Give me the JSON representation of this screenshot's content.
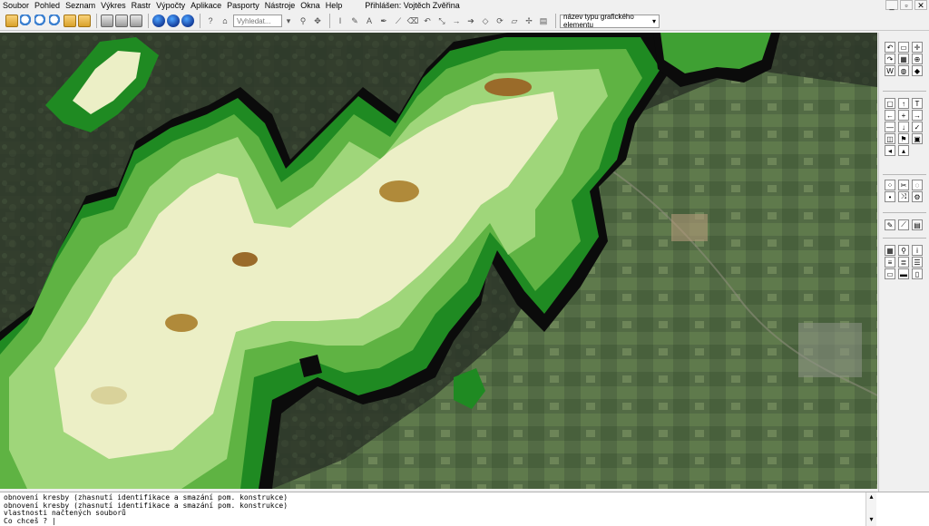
{
  "menu": {
    "items": [
      "Soubor",
      "Pohled",
      "Seznam",
      "Výkres",
      "Rastr",
      "Výpočty",
      "Aplikace",
      "Pasporty",
      "Nástroje",
      "Okna",
      "Help"
    ],
    "login": "Přihlášen: Vojtěch Zvěřina"
  },
  "toolbar": {
    "search_placeholder": "Vyhledat...",
    "element_type": "název typu grafického elementu"
  },
  "console": {
    "lines": [
      "obnovení kresby (zhasnutí identifikace a smazání pom. konstrukce)",
      "obnovení kresby (zhasnutí identifikace a smazání pom. konstrukce)",
      "vlastnosti načtených souborů",
      "Co chceš ? |"
    ]
  },
  "colors": {
    "elev_low": "#1f8a22",
    "elev_mid": "#79c24a",
    "elev_high": "#f4f2c9",
    "elev_peak": "#9a6b2a"
  },
  "icons": [
    "folder-icon",
    "zoom-in-icon",
    "zoom-out-icon",
    "print-icon",
    "globe-icon",
    "help-icon",
    "home-icon",
    "search-icon",
    "pan-icon",
    "text-icon",
    "pencil-icon",
    "undo-icon",
    "redo-icon",
    "layers-icon"
  ]
}
